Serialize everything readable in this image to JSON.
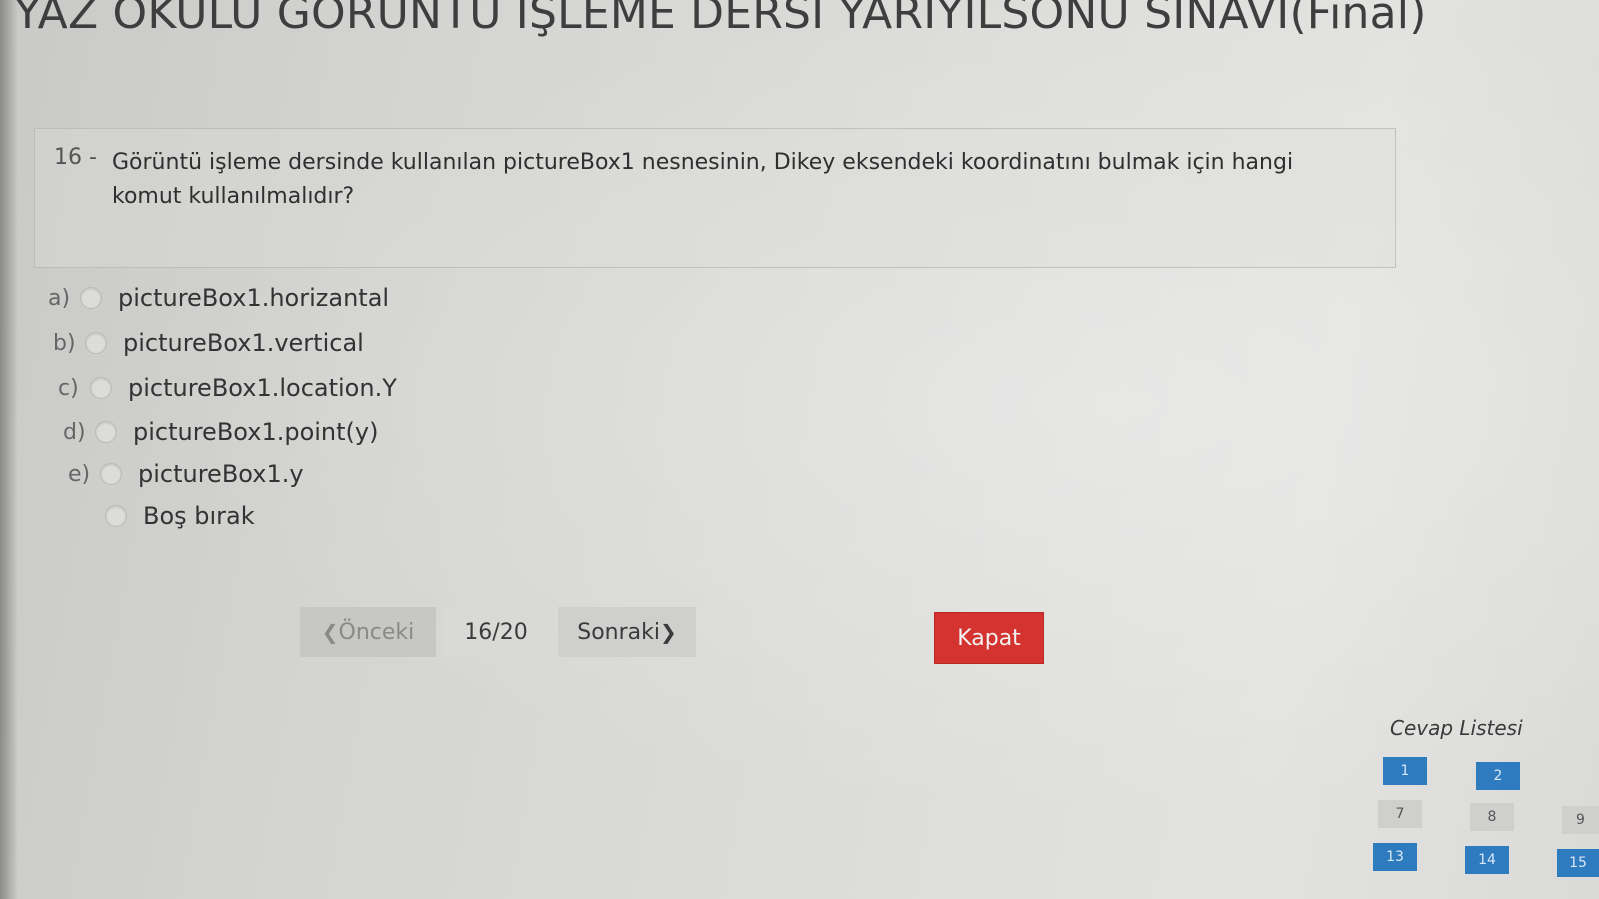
{
  "exam": {
    "title": "YAZ OKULU GÖRÜNTÜ İŞLEME DERSİ YARIYILSONU SINAVI(Final)"
  },
  "question": {
    "number": "16 -",
    "text": "Görüntü işleme dersinde kullanılan pictureBox1 nesnesinin, Dikey eksendeki koordinatını bulmak için hangi komut kullanılmalıdır?"
  },
  "options": [
    {
      "letter": "a)",
      "text": "pictureBox1.horizantal",
      "selected": false
    },
    {
      "letter": "b)",
      "text": "pictureBox1.vertical",
      "selected": false
    },
    {
      "letter": "c)",
      "text": "pictureBox1.location.Y",
      "selected": false
    },
    {
      "letter": "d)",
      "text": "pictureBox1.point(y)",
      "selected": false
    },
    {
      "letter": "e)",
      "text": "pictureBox1.y",
      "selected": false
    },
    {
      "letter": "",
      "text": "Boş bırak",
      "selected": false
    }
  ],
  "navigation": {
    "prev_label": "Önceki",
    "page_indicator": "16/20",
    "next_label": "Sonraki",
    "prev_icon": "chevron-left-icon",
    "next_icon": "chevron-right-icon"
  },
  "close_button": {
    "label": "Kapat",
    "color": "#d4332f"
  },
  "answer_list": {
    "title": "Cevap Listesi",
    "answered_color": "#2f7bc0",
    "unanswered_color": "#cfcfcd",
    "cells": [
      {
        "label": "1",
        "answered": true
      },
      {
        "label": "2",
        "answered": true
      },
      {
        "label": "7",
        "answered": false
      },
      {
        "label": "8",
        "answered": false
      },
      {
        "label": "9",
        "answered": false
      },
      {
        "label": "13",
        "answered": true
      },
      {
        "label": "14",
        "answered": true
      },
      {
        "label": "15",
        "answered": true
      }
    ]
  }
}
